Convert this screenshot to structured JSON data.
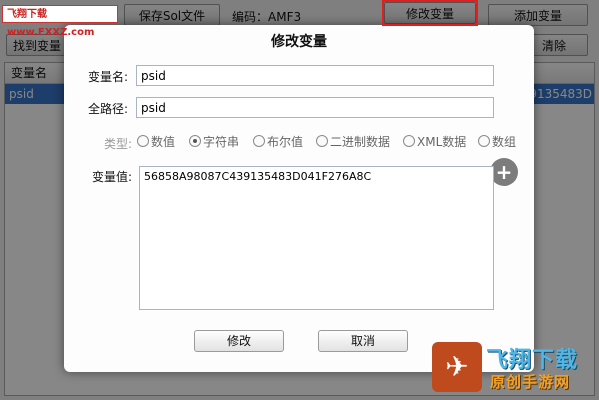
{
  "watermark_top": "飞翔下载 www.FXXZ.com",
  "toolbar": {
    "save_sol_label": "保存Sol文件",
    "encoding_label": "编码：AMF3",
    "edit_var_label": "修改变量",
    "add_var_label": "添加变量",
    "find_var_label": "找到变量",
    "clear_label": "清除"
  },
  "list": {
    "header_name": "变量名",
    "row_name": "psid",
    "row_value_tail": "9135483D"
  },
  "dialog": {
    "title": "修改变量",
    "var_name_label": "变量名:",
    "var_name_value": "psid",
    "full_path_label": "全路径:",
    "full_path_value": "psid",
    "type_label": "类型:",
    "types": [
      "数值",
      "字符串",
      "布尔值",
      "二进制数据",
      "XML数据",
      "数组"
    ],
    "selected_type": "字符串",
    "value_label": "变量值:",
    "value_text": "56858A98087C439135483D041F276A8C",
    "confirm_label": "修改",
    "cancel_label": "取消"
  },
  "watermark_brand": {
    "line1": "飞翔下载",
    "line2": "原创手游网"
  },
  "colors": {
    "selected_row": "#3874c8",
    "highlight": "#e02020"
  }
}
